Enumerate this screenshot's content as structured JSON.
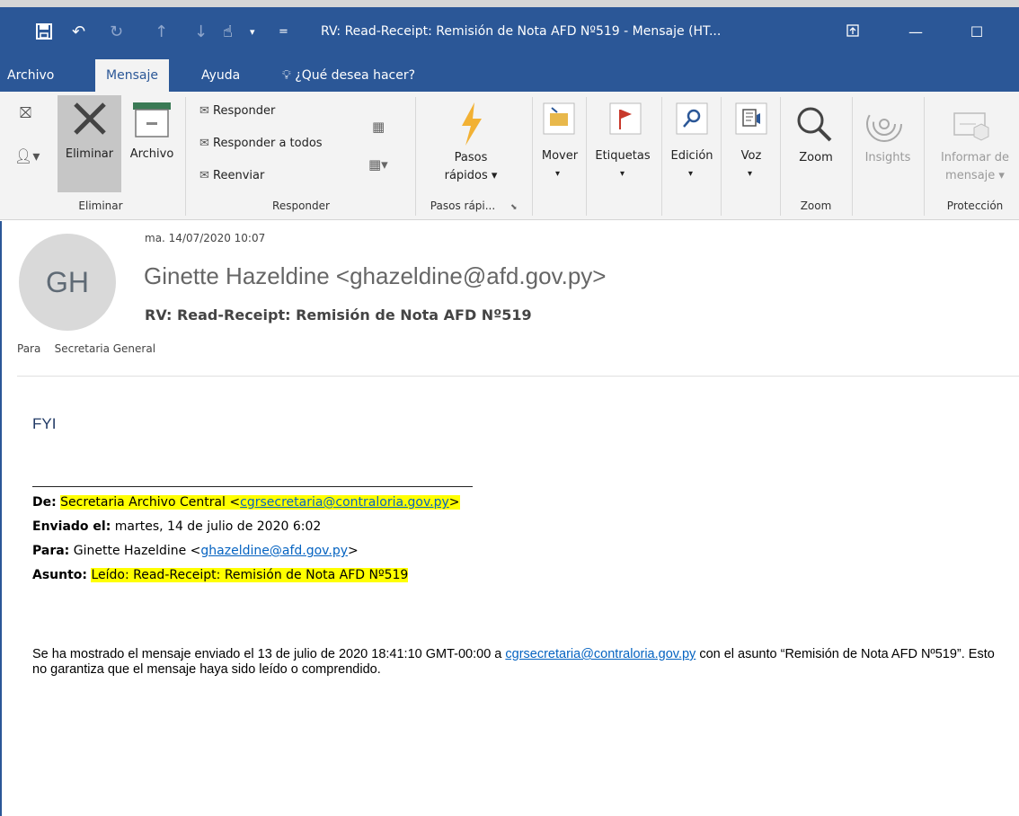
{
  "window": {
    "title": "RV: Read-Receipt: Remisión de Nota AFD Nº519  -  Mensaje (HT...",
    "accent": "#2b5797"
  },
  "menu_tabs": {
    "archivo": "Archivo",
    "mensaje": "Mensaje",
    "ayuda": "Ayuda",
    "search_placeholder": "¿Qué desea hacer?"
  },
  "ribbon": {
    "eliminar_button": "Eliminar",
    "archivo_button": "Archivo",
    "group_eliminar": "Eliminar",
    "responder": "Responder",
    "responder_todos": "Responder a todos",
    "reenviar": "Reenviar",
    "group_responder": "Responder",
    "pasos_line1": "Pasos",
    "pasos_line2": "rápidos ▾",
    "group_pasos": "Pasos rápi...",
    "mover": "Mover",
    "etiquetas": "Etiquetas",
    "edicion": "Edición",
    "voz": "Voz",
    "zoom_button": "Zoom",
    "group_zoom": "Zoom",
    "insights": "Insights",
    "informar_line1": "Informar de",
    "informar_line2": "mensaje ▾",
    "group_proteccion": "Protección"
  },
  "message": {
    "avatar_initials": "GH",
    "date": "ma. 14/07/2020 10:07",
    "from": "Ginette Hazeldine <ghazeldine@afd.gov.py>",
    "subject": "RV: Read-Receipt: Remisión de Nota AFD Nº519",
    "to_label": "Para",
    "to_value": "Secretaria General"
  },
  "body": {
    "fyi": "FYI",
    "de_label": "De:",
    "de_name": "Secretaria Archivo Central <",
    "de_email": "cgrsecretaria@contraloria.gov.py",
    "de_close": ">",
    "enviado_label": "Enviado el:",
    "enviado_value": " martes, 14 de julio de 2020 6:02",
    "para_label": "Para:",
    "para_name": " Ginette Hazeldine <",
    "para_email": "ghazeldine@afd.gov.py",
    "para_close": ">",
    "asunto_label": "Asunto:",
    "asunto_value": "Leído: Read-Receipt: Remisión de Nota AFD Nº519",
    "para1_a": "Se ha mostrado el mensaje enviado el 13 de julio de 2020 18:41:10 GMT-00:00 a ",
    "para1_email": "cgrsecretaria@contraloria.gov.py",
    "para1_b": " con el asunto “Remisión de Nota AFD Nº519”. Esto no garantiza que el mensaje haya sido leído o comprendido."
  }
}
